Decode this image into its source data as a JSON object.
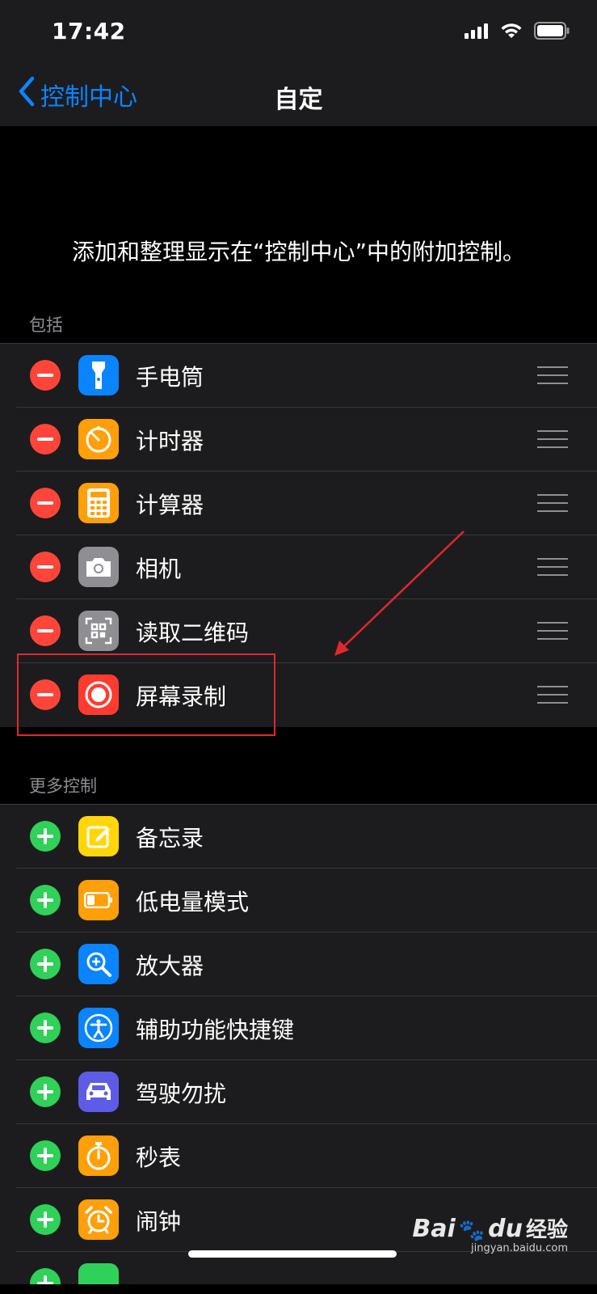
{
  "status_bar": {
    "time": "17:42"
  },
  "nav": {
    "back_label": "控制中心",
    "title": "自定"
  },
  "description": "添加和整理显示在“控制中心”中的附加控制。",
  "included": {
    "header": "包括",
    "items": [
      {
        "label": "手电筒",
        "icon": "flashlight-icon",
        "color": "#0a84ff"
      },
      {
        "label": "计时器",
        "icon": "timer-icon",
        "color": "#ff9f0a"
      },
      {
        "label": "计算器",
        "icon": "calculator-icon",
        "color": "#ff9f0a"
      },
      {
        "label": "相机",
        "icon": "camera-icon",
        "color": "#8e8e93"
      },
      {
        "label": "读取二维码",
        "icon": "qr-code-icon",
        "color": "#8e8e93"
      },
      {
        "label": "屏幕录制",
        "icon": "screen-record-icon",
        "color": "#ff3b30"
      }
    ]
  },
  "more": {
    "header": "更多控制",
    "items": [
      {
        "label": "备忘录",
        "icon": "notes-icon",
        "color": "#ffd60a"
      },
      {
        "label": "低电量模式",
        "icon": "low-power-icon",
        "color": "#ff9f0a"
      },
      {
        "label": "放大器",
        "icon": "magnifier-icon",
        "color": "#0a84ff"
      },
      {
        "label": "辅助功能快捷键",
        "icon": "accessibility-icon",
        "color": "#0a84ff"
      },
      {
        "label": "驾驶勿扰",
        "icon": "car-icon",
        "color": "#5e5ce6"
      },
      {
        "label": "秒表",
        "icon": "stopwatch-icon",
        "color": "#ff9f0a"
      },
      {
        "label": "闹钟",
        "icon": "alarm-icon",
        "color": "#ff9f0a"
      }
    ]
  },
  "watermark": {
    "brand": "Bai",
    "brand_suffix": "du",
    "cn": "经验",
    "url": "jingyan.baidu.com"
  },
  "colors": {
    "accent": "#0a84ff",
    "remove": "#ff453a",
    "add": "#30d158",
    "annotation": "#e0282c"
  }
}
